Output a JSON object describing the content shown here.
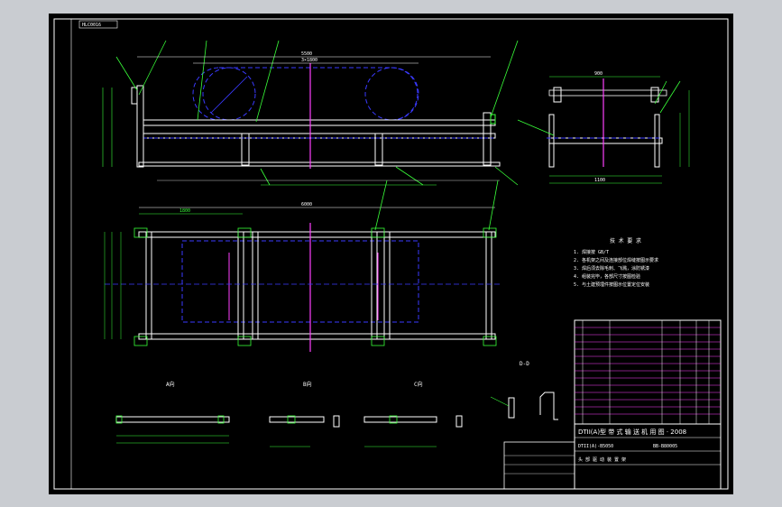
{
  "drawing": {
    "corner_tag": "HLC0016",
    "notes_title": "技 术 要 求",
    "notes_lines": [
      "1. 焊接按 GB/T",
      "2. 各机架之间及连接部位焊缝按图示要求",
      "3. 焊后须去除毛刺、飞溅，涂防锈漆",
      "4. 组装完毕，各部尺寸按图检验",
      "5. 与土建预埋件按图示位置定位安装"
    ],
    "view_labels": [
      "A向",
      "B向",
      "C向",
      "D-D"
    ],
    "dims": {
      "top_total": "5500",
      "top_inner": "3×1800",
      "plan_total": "6000",
      "plan_span": "1800",
      "side_top": "900",
      "side_bottom": "1100"
    },
    "title_block": {
      "title": "DTII(A)型 带 式 输 送 机 用 图 · 2008",
      "drawing_no": "DTII(A)-B5050",
      "code": "BB-B80005",
      "part_name": "头 部 驱 动 装 置 架"
    }
  }
}
